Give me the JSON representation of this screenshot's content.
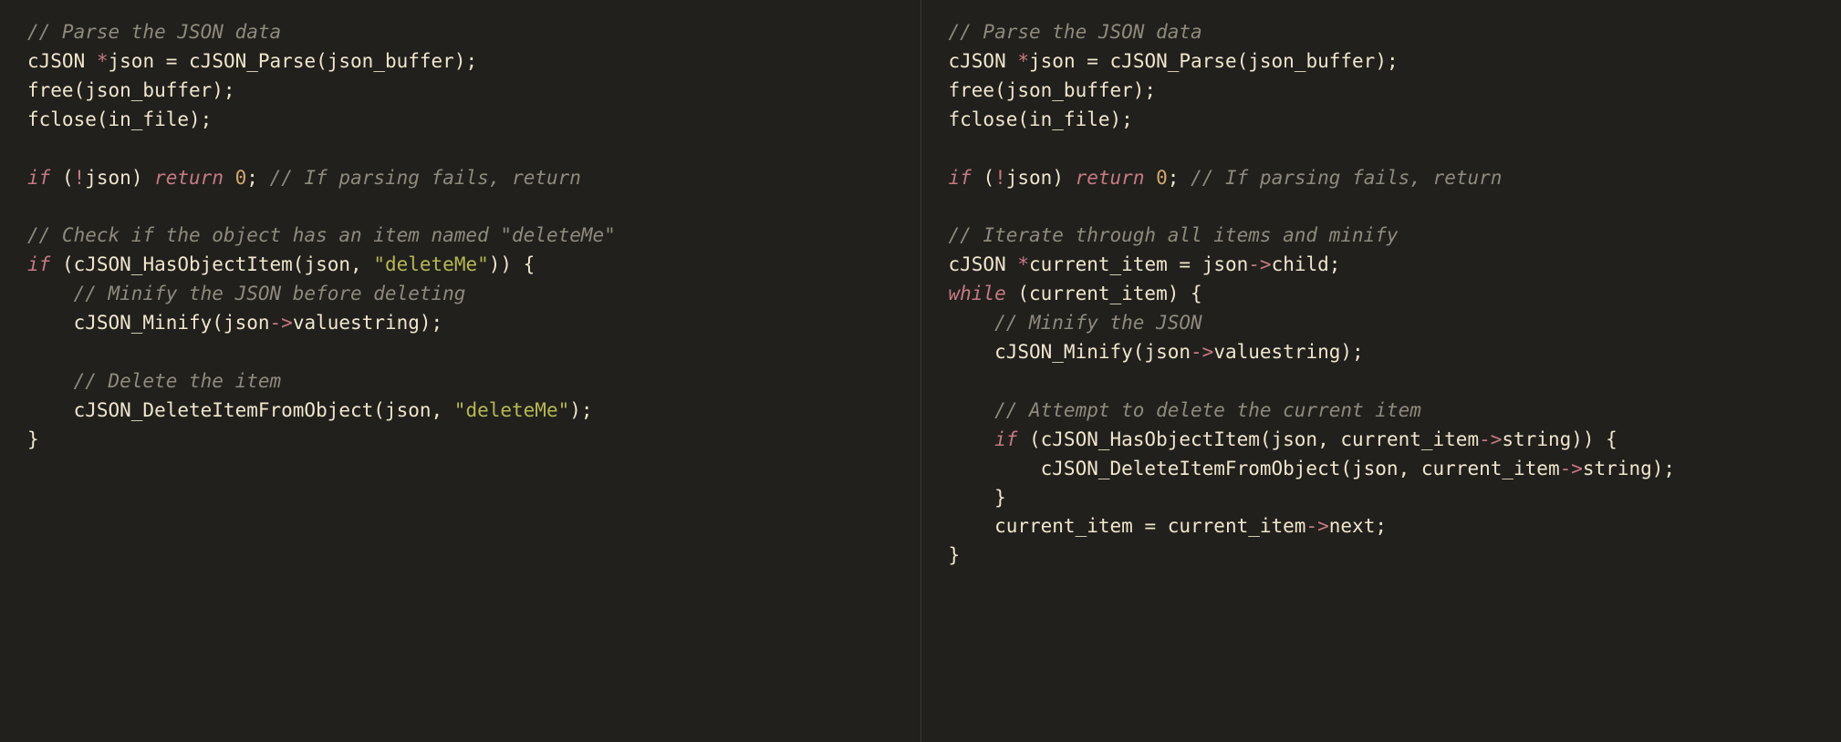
{
  "left": {
    "l1_comment": "// Parse the JSON data",
    "l2a": "cJSON ",
    "l2b": "*",
    "l2c": "json ",
    "l2d": "=",
    "l2e": " cJSON_Parse(json_buffer);",
    "l3": "free(json_buffer);",
    "l4": "fclose(in_file);",
    "l6a": "if",
    "l6b": " (",
    "l6c": "!",
    "l6d": "json) ",
    "l6e": "return",
    "l6f": " ",
    "l6g": "0",
    "l6h": "; ",
    "l6i": "// If parsing fails, return",
    "l8_comment": "// Check if the object has an item named \"deleteMe\"",
    "l9a": "if",
    "l9b": " (cJSON_HasObjectItem(json, ",
    "l9c": "\"deleteMe\"",
    "l9d": ")) {",
    "l10_comment": "    // Minify the JSON before deleting",
    "l11a": "    cJSON_Minify(json",
    "l11b": "->",
    "l11c": "valuestring);",
    "l13_comment": "    // Delete the item",
    "l14a": "    cJSON_DeleteItemFromObject(json, ",
    "l14b": "\"deleteMe\"",
    "l14c": ");",
    "l15": "}"
  },
  "right": {
    "r1_comment": "// Parse the JSON data",
    "r2a": "cJSON ",
    "r2b": "*",
    "r2c": "json ",
    "r2d": "=",
    "r2e": " cJSON_Parse(json_buffer);",
    "r3": "free(json_buffer);",
    "r4": "fclose(in_file);",
    "r6a": "if",
    "r6b": " (",
    "r6c": "!",
    "r6d": "json) ",
    "r6e": "return",
    "r6f": " ",
    "r6g": "0",
    "r6h": "; ",
    "r6i": "// If parsing fails, return",
    "r8_comment": "// Iterate through all items and minify",
    "r9a": "cJSON ",
    "r9b": "*",
    "r9c": "current_item ",
    "r9d": "=",
    "r9e": " json",
    "r9f": "->",
    "r9g": "child;",
    "r10a": "while",
    "r10b": " (current_item) {",
    "r11_comment": "    // Minify the JSON",
    "r12a": "    cJSON_Minify(json",
    "r12b": "->",
    "r12c": "valuestring);",
    "r14_comment": "    // Attempt to delete the current item",
    "r15a": "    if",
    "r15b": " (cJSON_HasObjectItem(json, current_item",
    "r15c": "->",
    "r15d": "string)) {",
    "r16a": "        cJSON_DeleteItemFromObject(json, current_item",
    "r16b": "->",
    "r16c": "string);",
    "r17": "    }",
    "r18a": "    current_item ",
    "r18b": "=",
    "r18c": " current_item",
    "r18d": "->",
    "r18e": "next;",
    "r19": "}"
  }
}
